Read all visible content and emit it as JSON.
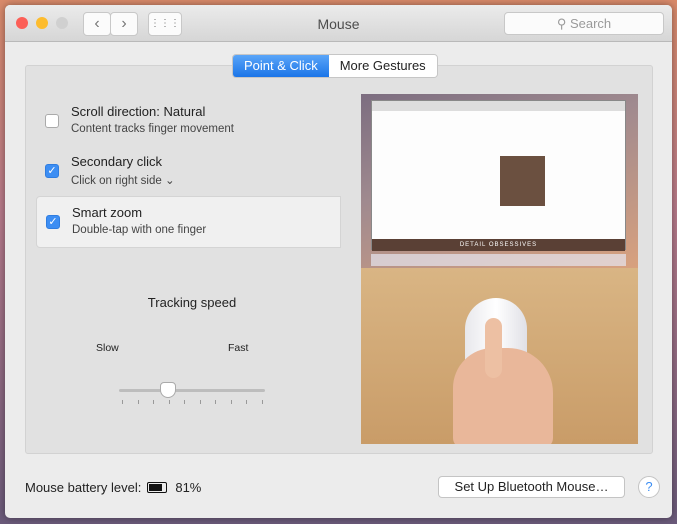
{
  "window": {
    "title": "Mouse",
    "search_placeholder": "Search",
    "back": "‹",
    "forward": "›",
    "grid": "⋮⋮⋮"
  },
  "tabs": [
    {
      "label": "Point & Click",
      "selected": true
    },
    {
      "label": "More Gestures",
      "selected": false
    }
  ],
  "options": [
    {
      "title": "Scroll direction: Natural",
      "subtitle": "Content tracks finger movement",
      "checked": false
    },
    {
      "title": "Secondary click",
      "subtitle": "Click on right side ⌄",
      "checked": true
    },
    {
      "title": "Smart zoom",
      "subtitle": "Double-tap with one finger",
      "checked": true
    }
  ],
  "tracking": {
    "label": "Tracking speed",
    "min_label": "Slow",
    "max_label": "Fast",
    "value": 0.33,
    "ticks": 10
  },
  "battery": {
    "label": "Mouse battery level:",
    "value": "81%",
    "level": 0.81
  },
  "bluetooth_button": "Set Up Bluetooth Mouse…",
  "help": "?",
  "preview": {
    "banner": "DETAIL OBSESSIVES"
  },
  "colors": {
    "accent": "#3d8ef3",
    "close": "#fc5f57",
    "minimize": "#fdbc2e"
  }
}
